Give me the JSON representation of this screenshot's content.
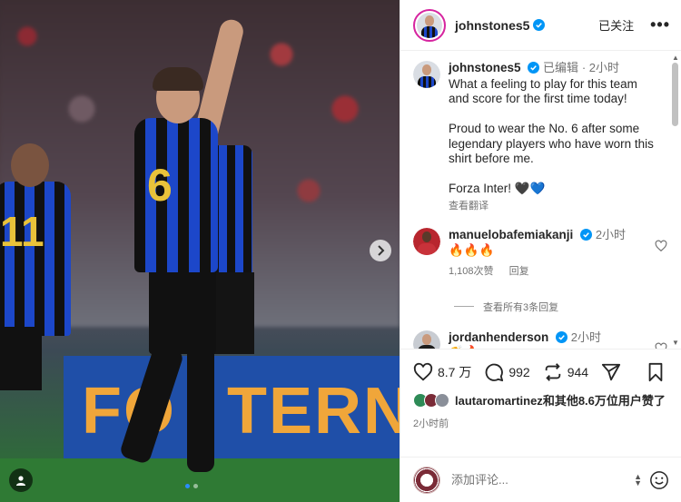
{
  "post": {
    "image_alt": "",
    "carousel": {
      "count": 2,
      "active": 0
    }
  },
  "header": {
    "username": "johnstones5",
    "follow_state": "已关注",
    "more": "•••"
  },
  "caption": {
    "username": "johnstones5",
    "edited": "已编辑",
    "time": "2小时",
    "text": "What a feeling to play for this team and score for the first time today!\n\nProud to wear the No. 6 after some legendary players who have worn this shirt before me.\n\nForza Inter! 🖤💙",
    "translate": "查看翻译"
  },
  "comments": [
    {
      "username": "manuelobafemiakanji",
      "time": "2小时",
      "text": "🔥🔥🔥",
      "likes": "1,108次赞",
      "reply": "回复",
      "view_replies": "查看所有3条回复"
    },
    {
      "username": "jordanhenderson",
      "time": "2小时",
      "text": "👏🔥"
    }
  ],
  "actions": {
    "likes": "8.7 万",
    "comments": "992",
    "reposts": "944"
  },
  "liked_by": {
    "user": "lautaromartinez",
    "rest": "和其他8.6万位用户赞了"
  },
  "time_ago": "2小时前",
  "add_comment": {
    "placeholder": "添加评论..."
  },
  "colors": {
    "verified": "#0095f6",
    "carousel_dot_active": "#2b8cff",
    "ring": "#d6249f"
  },
  "icons": [
    "chevron-right-icon",
    "user-tag-icon",
    "verified-badge-icon",
    "heart-icon",
    "comment-icon",
    "repost-icon",
    "share-icon",
    "bookmark-icon",
    "emoji-icon"
  ]
}
